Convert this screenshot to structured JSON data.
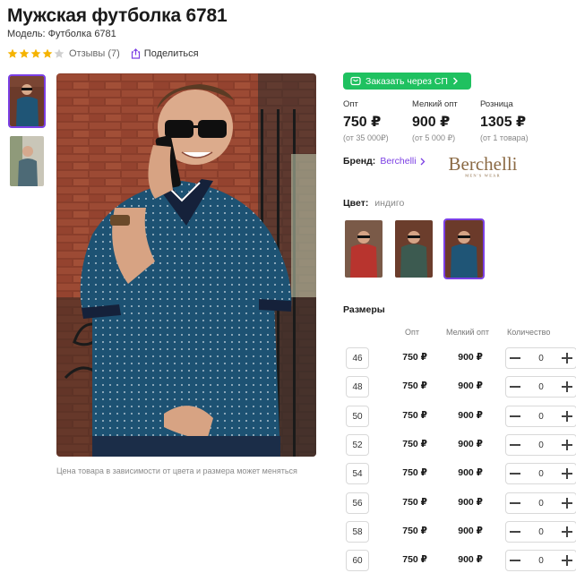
{
  "product": {
    "title": "Мужская футболка 6781",
    "model_label": "Модель: Футболка 6781",
    "rating": 4,
    "rating_max": 5,
    "reviews_label": "Отзывы (7)",
    "share_label": "Поделиться"
  },
  "gallery": {
    "note": "Цена товара в зависимости от цвета и размера может меняться",
    "thumbnails": [
      {
        "name": "thumb-indigo",
        "active": true
      },
      {
        "name": "thumb-olive",
        "active": false
      }
    ]
  },
  "order_button": {
    "label": "Заказать через СП"
  },
  "prices": [
    {
      "label": "Опт",
      "value": "750 ₽",
      "sub": "(от 35 000₽)"
    },
    {
      "label": "Мелкий опт",
      "value": "900 ₽",
      "sub": "(от 5 000 ₽)"
    },
    {
      "label": "Розница",
      "value": "1305 ₽",
      "sub": "(от 1 товара)"
    }
  ],
  "brand": {
    "label": "Бренд:",
    "name": "Berchelli",
    "logo_text": "Berchelli",
    "logo_subtext": "MEN'S WEAR"
  },
  "color": {
    "label": "Цвет:",
    "value": "индиго",
    "swatches": [
      {
        "name": "red",
        "active": false
      },
      {
        "name": "olive",
        "active": false
      },
      {
        "name": "indigo",
        "active": true
      }
    ]
  },
  "sizes": {
    "title": "Размеры",
    "headers": {
      "opt": "Опт",
      "small_opt": "Мелкий опт",
      "quantity": "Количество"
    },
    "rows": [
      {
        "size": "46",
        "opt": "750 ₽",
        "small_opt": "900 ₽",
        "qty": "0"
      },
      {
        "size": "48",
        "opt": "750 ₽",
        "small_opt": "900 ₽",
        "qty": "0"
      },
      {
        "size": "50",
        "opt": "750 ₽",
        "small_opt": "900 ₽",
        "qty": "0"
      },
      {
        "size": "52",
        "opt": "750 ₽",
        "small_opt": "900 ₽",
        "qty": "0"
      },
      {
        "size": "54",
        "opt": "750 ₽",
        "small_opt": "900 ₽",
        "qty": "0"
      },
      {
        "size": "56",
        "opt": "750 ₽",
        "small_opt": "900 ₽",
        "qty": "0"
      },
      {
        "size": "58",
        "opt": "750 ₽",
        "small_opt": "900 ₽",
        "qty": "0"
      },
      {
        "size": "60",
        "opt": "750 ₽",
        "small_opt": "900 ₽",
        "qty": "0"
      }
    ]
  },
  "colors": {
    "accent": "#7b3fe4",
    "order_button": "#1fc160",
    "star": "#f5b301",
    "star_empty": "#d0d0d0"
  }
}
